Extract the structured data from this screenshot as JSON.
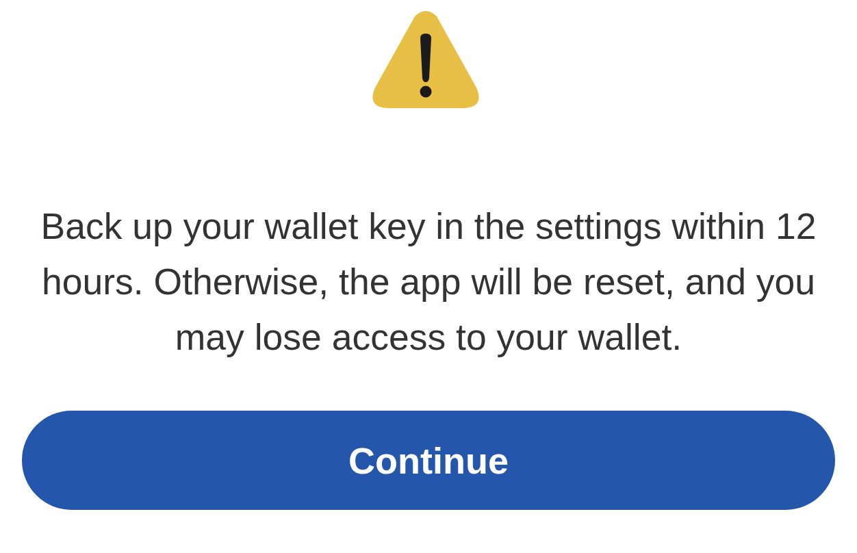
{
  "message": "Back up your wallet key in the settings within 12 hours. Otherwise, the app will be reset, and you may lose access to your wallet.",
  "button": {
    "label": "Continue"
  }
}
